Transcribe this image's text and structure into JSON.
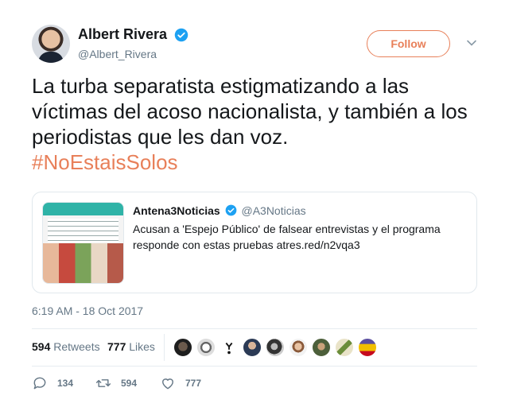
{
  "author": {
    "display_name": "Albert Rivera",
    "handle": "@Albert_Rivera",
    "follow_label": "Follow"
  },
  "tweet": {
    "text": "La turba separatista estigmatizando a las víctimas del acoso nacionalista, y también a los periodistas que les dan voz.",
    "hashtag": "#NoEstaisSolos",
    "timestamp": "6:19 AM - 18 Oct 2017"
  },
  "quoted": {
    "name": "Antena3Noticias",
    "handle": "@A3Noticias",
    "text": "Acusan a 'Espejo Público' de falsear entrevistas y el programa responde con estas pruebas atres.red/n2vqa3"
  },
  "stats": {
    "retweets_count": "594",
    "retweets_label": "Retweets",
    "likes_count": "777",
    "likes_label": "Likes"
  },
  "actions": {
    "replies": "134",
    "retweets": "594",
    "likes": "777"
  },
  "colors": {
    "accent": "#e8805a",
    "verified": "#1da1f2",
    "muted": "#657786"
  }
}
